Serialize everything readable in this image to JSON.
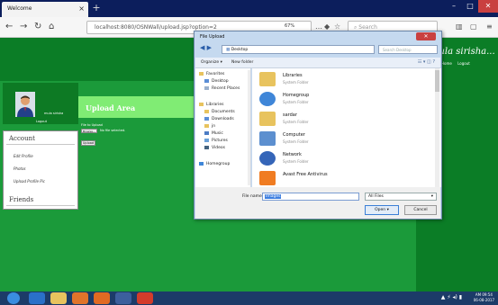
{
  "browser": {
    "tab_title": "Welcome",
    "tab_close": "×",
    "new_tab": "+",
    "url": "localhost:8080/OSNWall/upload.jsp?option=2",
    "zoom": "67%",
    "search_placeholder": "Search"
  },
  "site": {
    "brand": "mula sirisha...",
    "header_links": [
      "Home",
      "Logout"
    ],
    "user_name": "mula sirisha",
    "logout": "Logout"
  },
  "sidebar": {
    "account_title": "Account",
    "account_links": [
      "Edit Profile",
      "Photos",
      "Upload Profile Pic"
    ],
    "friends_title": "Friends"
  },
  "upload": {
    "title": "Upload Area",
    "label": "File to Upload",
    "browse_label": "Browse...",
    "no_file": "No file selected.",
    "submit_label": "Upload"
  },
  "dialog": {
    "title": "File Upload",
    "close": "✕",
    "path": "Desktop",
    "search_placeholder": "Search Desktop",
    "organize_label": "Organize ▾",
    "new_folder_label": "New folder",
    "nav_items": [
      "Favorites",
      "Desktop",
      "Recent Places",
      "Libraries",
      "Documents",
      "Downloads",
      "jn",
      "Music",
      "Pictures",
      "Videos",
      "Homegroup"
    ],
    "files": [
      {
        "name": "Libraries",
        "type": "System Folder",
        "color": "#e8c35e"
      },
      {
        "name": "Homegroup",
        "type": "System Folder",
        "color": "#3f86d8"
      },
      {
        "name": "sardar",
        "type": "System Folder",
        "color": "#e8c35e"
      },
      {
        "name": "Computer",
        "type": "System Folder",
        "color": "#5c8fcf"
      },
      {
        "name": "Network",
        "type": "System Folder",
        "color": "#3565b8"
      },
      {
        "name": "Avast Free Antivirus",
        "type": "",
        "color": "#f07c22"
      }
    ],
    "file_name_label": "File name:",
    "file_name_value": "Images",
    "file_type": "All Files",
    "open_label": "Open",
    "cancel_label": "Cancel"
  },
  "taskbar": {
    "apps": [
      {
        "name": "start",
        "color": "#3a8de0"
      },
      {
        "name": "ie",
        "color": "#2a70c8"
      },
      {
        "name": "explorer",
        "color": "#e8c35e"
      },
      {
        "name": "media",
        "color": "#e0742a"
      },
      {
        "name": "firefox",
        "color": "#e06a22"
      },
      {
        "name": "java",
        "color": "#3c5f9c"
      },
      {
        "name": "app-red",
        "color": "#d33c2b"
      }
    ],
    "time": "AM 09:54",
    "date": "06-08-2017"
  }
}
